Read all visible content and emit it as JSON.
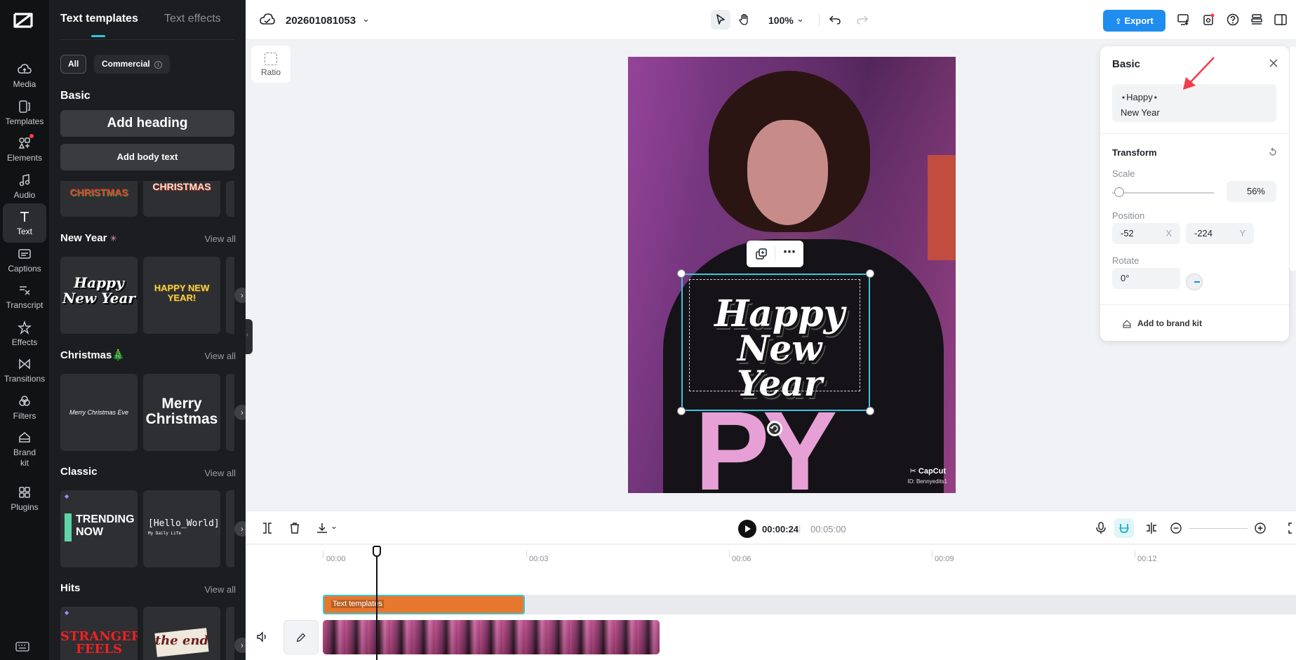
{
  "rail": {
    "items": [
      {
        "label": "Media",
        "icon": "cloud-upload-icon"
      },
      {
        "label": "Templates",
        "icon": "templates-icon"
      },
      {
        "label": "Elements",
        "icon": "elements-icon"
      },
      {
        "label": "Audio",
        "icon": "music-note-icon"
      },
      {
        "label": "Text",
        "icon": "text-icon"
      },
      {
        "label": "Captions",
        "icon": "captions-icon"
      },
      {
        "label": "Transcript",
        "icon": "transcript-icon"
      },
      {
        "label": "Effects",
        "icon": "effects-icon"
      },
      {
        "label": "Transitions",
        "icon": "transitions-icon"
      },
      {
        "label": "Filters",
        "icon": "filters-icon"
      },
      {
        "label": "Brand kit",
        "icon": "brand-kit-icon"
      },
      {
        "label": "Plugins",
        "icon": "plugins-icon"
      }
    ]
  },
  "panel": {
    "tab_text_templates": "Text templates",
    "tab_text_effects": "Text effects",
    "chip_all": "All",
    "chip_commercial": "Commercial",
    "basic_title": "Basic",
    "add_heading": "Add heading",
    "add_body": "Add body text",
    "view_all": "View all",
    "sections": {
      "new_year": "New Year",
      "christmas": "Christmas🎄",
      "classic": "Classic",
      "hits": "Hits"
    },
    "cards": {
      "christmas_strip_1": "CHRISTMAS",
      "christmas_strip_2": "CHRISTMAS",
      "ny_1_line1": "Happy",
      "ny_1_line2": "New Year",
      "ny_2_line1": "HAPPY NEW",
      "ny_2_line2": "YEAR!",
      "xmas_1": "Merry Christmas Eve",
      "xmas_2_line1": "Merry",
      "xmas_2_line2": "Christmas",
      "classic_1_line1": "TRENDING",
      "classic_1_line2": "NOW",
      "classic_2_line1": "[Hello_World]",
      "classic_2_line2": "My Daily Life",
      "hits_1_line1": "STRANGER",
      "hits_1_line2": "FEELS",
      "hits_2": "the end"
    }
  },
  "topbar": {
    "project_name": "202601081053",
    "zoom": "100%",
    "export": "Export"
  },
  "canvas": {
    "ratio_label": "Ratio",
    "overlay_line1": "Happy",
    "overlay_line2": "New Year",
    "watermark": "CapCut",
    "watermark_id": "ID: Bennyedits1"
  },
  "props": {
    "title": "Basic",
    "text_value_line1": "⋆Happy⋆",
    "text_value_line2": "New Year",
    "transform": "Transform",
    "scale_label": "Scale",
    "scale_value": "56%",
    "scale_fraction": 0.56,
    "position_label": "Position",
    "pos_x": "-52",
    "pos_x_axis": "X",
    "pos_y": "-224",
    "pos_y_axis": "Y",
    "rotate_label": "Rotate",
    "rotate_value": "0°",
    "brand_kit": "Add to brand kit"
  },
  "timeline": {
    "current_time": "00:00:24",
    "separator": "|",
    "total_time": "00:05:00",
    "ticks": [
      "00:00",
      "00:03",
      "00:06",
      "00:09",
      "00:12"
    ],
    "text_clip_label": "Text templates"
  },
  "colors": {
    "accent": "#1f8cf0",
    "selection": "#3bc6da",
    "text_clip": "#e8772e",
    "dark_panel": "#1c1d20"
  }
}
